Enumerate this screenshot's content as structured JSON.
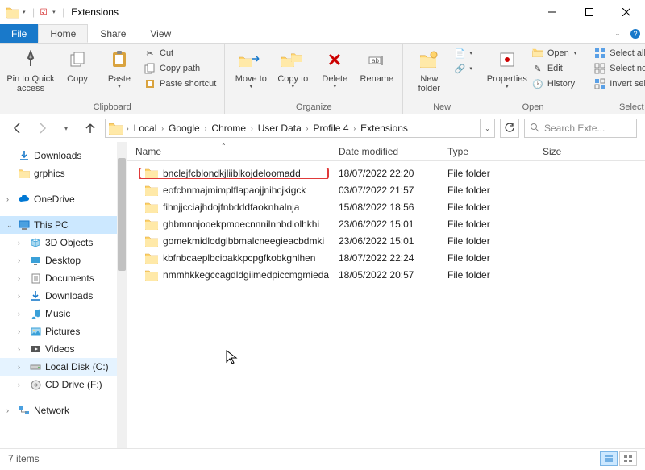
{
  "window_title": "Extensions",
  "tabs": {
    "file": "File",
    "home": "Home",
    "share": "Share",
    "view": "View"
  },
  "ribbon": {
    "clipboard": {
      "label": "Clipboard",
      "pin": "Pin to Quick access",
      "copy": "Copy",
      "paste": "Paste",
      "cut": "Cut",
      "copy_path": "Copy path",
      "paste_shortcut": "Paste shortcut"
    },
    "organize": {
      "label": "Organize",
      "move_to": "Move to",
      "copy_to": "Copy to",
      "delete": "Delete",
      "rename": "Rename"
    },
    "new": {
      "label": "New",
      "new_folder": "New folder"
    },
    "open": {
      "label": "Open",
      "properties": "Properties",
      "open": "Open",
      "edit": "Edit",
      "history": "History"
    },
    "select": {
      "label": "Select",
      "select_all": "Select all",
      "select_none": "Select none",
      "invert": "Invert selection"
    }
  },
  "breadcrumbs": [
    "Local",
    "Google",
    "Chrome",
    "User Data",
    "Profile 4",
    "Extensions"
  ],
  "search_placeholder": "Search Exte...",
  "nav": {
    "downloads": "Downloads",
    "grphics": "grphics",
    "onedrive": "OneDrive",
    "this_pc": "This PC",
    "objects3d": "3D Objects",
    "desktop": "Desktop",
    "documents": "Documents",
    "downloads2": "Downloads",
    "music": "Music",
    "pictures": "Pictures",
    "videos": "Videos",
    "local_disk": "Local Disk (C:)",
    "cd_drive": "CD Drive (F:)",
    "network": "Network"
  },
  "columns": {
    "name": "Name",
    "date": "Date modified",
    "type": "Type",
    "size": "Size"
  },
  "rows": [
    {
      "name": "bnclejfcblondkjliiblkojdeloomadd",
      "date": "18/07/2022 22:20",
      "type": "File folder",
      "highlight": true
    },
    {
      "name": "eofcbnmajmimplflapaojjnihcjkigck",
      "date": "03/07/2022 21:57",
      "type": "File folder"
    },
    {
      "name": "fihnjjcciajhdojfnbdddfaoknhalnja",
      "date": "15/08/2022 18:56",
      "type": "File folder"
    },
    {
      "name": "ghbmnnjooekpmoecnnnilnnbdlolhkhi",
      "date": "23/06/2022 15:01",
      "type": "File folder"
    },
    {
      "name": "gomekmidlodglbbmalcneegieacbdmki",
      "date": "23/06/2022 15:01",
      "type": "File folder"
    },
    {
      "name": "kbfnbcaeplbcioakkpcpgfkobkghlhen",
      "date": "18/07/2022 22:24",
      "type": "File folder"
    },
    {
      "name": "nmmhkkegccagdldgiimedpiccmgmieda",
      "date": "18/05/2022 20:57",
      "type": "File folder"
    }
  ],
  "status_text": "7 items"
}
